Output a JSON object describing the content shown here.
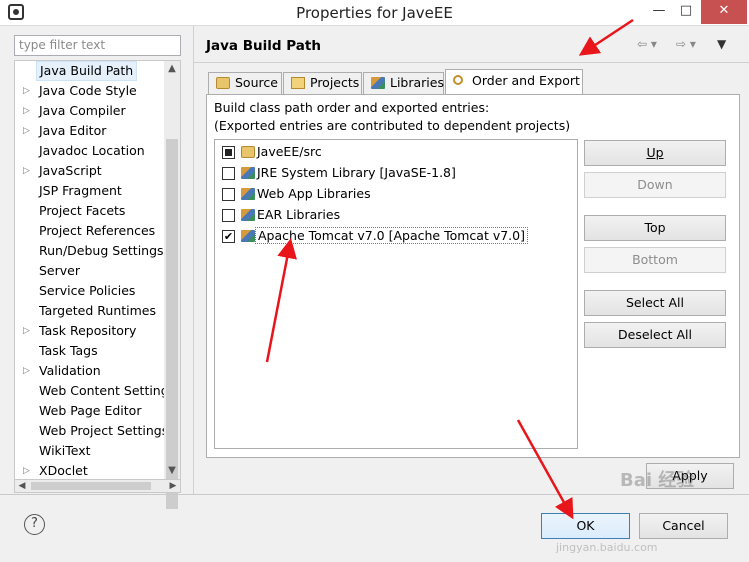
{
  "window": {
    "title": "Properties for JaveEE",
    "minimize": "—",
    "maximize": "□",
    "close": "✕"
  },
  "filter": {
    "placeholder": "type filter text"
  },
  "tree": {
    "items": [
      {
        "label": "Java Build Path",
        "arrow": "",
        "selected": true
      },
      {
        "label": "Java Code Style",
        "arrow": "▷"
      },
      {
        "label": "Java Compiler",
        "arrow": "▷"
      },
      {
        "label": "Java Editor",
        "arrow": "▷"
      },
      {
        "label": "Javadoc Location",
        "arrow": ""
      },
      {
        "label": "JavaScript",
        "arrow": "▷"
      },
      {
        "label": "JSP Fragment",
        "arrow": ""
      },
      {
        "label": "Project Facets",
        "arrow": ""
      },
      {
        "label": "Project References",
        "arrow": ""
      },
      {
        "label": "Run/Debug Settings",
        "arrow": ""
      },
      {
        "label": "Server",
        "arrow": ""
      },
      {
        "label": "Service Policies",
        "arrow": ""
      },
      {
        "label": "Targeted Runtimes",
        "arrow": ""
      },
      {
        "label": "Task Repository",
        "arrow": "▷"
      },
      {
        "label": "Task Tags",
        "arrow": ""
      },
      {
        "label": "Validation",
        "arrow": "▷"
      },
      {
        "label": "Web Content Settings",
        "arrow": ""
      },
      {
        "label": "Web Page Editor",
        "arrow": ""
      },
      {
        "label": "Web Project Settings",
        "arrow": ""
      },
      {
        "label": "WikiText",
        "arrow": ""
      },
      {
        "label": "XDoclet",
        "arrow": "▷"
      }
    ],
    "scroll_up": "▲",
    "scroll_down": "▼",
    "scroll_left": "◀",
    "scroll_right": "▶"
  },
  "page": {
    "title": "Java Build Path",
    "back": "⇦ ▾",
    "forward": "⇨ ▾",
    "menu": "▼"
  },
  "tabs": [
    {
      "label": "Source",
      "icon": "source-folder-icon"
    },
    {
      "label": "Projects",
      "icon": "projects-icon"
    },
    {
      "label": "Libraries",
      "icon": "libraries-icon"
    },
    {
      "label": "Order and Export",
      "icon": "order-export-icon",
      "active": true
    }
  ],
  "order_export": {
    "description_line1": "Build class path order and exported entries:",
    "description_line2": "(Exported entries are contributed to dependent projects)",
    "entries": [
      {
        "label": "JaveEE/src",
        "check": "partial",
        "icon": "source-folder-icon"
      },
      {
        "label": "JRE System Library [JavaSE-1.8]",
        "check": "",
        "icon": "library-icon"
      },
      {
        "label": "Web App Libraries",
        "check": "",
        "icon": "library-icon"
      },
      {
        "label": "EAR Libraries",
        "check": "",
        "icon": "library-icon"
      },
      {
        "label": "Apache Tomcat v7.0 [Apache Tomcat v7.0]",
        "check": "✔",
        "icon": "library-icon",
        "selected": true
      }
    ],
    "buttons": {
      "up": "Up",
      "down": "Down",
      "top": "Top",
      "bottom": "Bottom",
      "select_all": "Select All",
      "deselect_all": "Deselect All"
    }
  },
  "apply": "Apply",
  "footer": {
    "help": "?",
    "ok": "OK",
    "cancel": "Cancel"
  },
  "watermark": {
    "text": "Bai 经验",
    "sub": "jingyan.baidu.com"
  },
  "annotation_color": "#e8151b"
}
